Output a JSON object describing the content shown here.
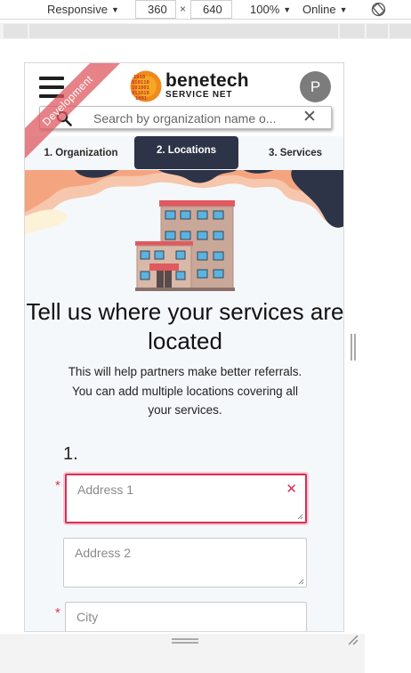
{
  "devtools": {
    "device": "Responsive",
    "width": "360",
    "height": "640",
    "times": "×",
    "zoom": "100%",
    "network": "Online",
    "icons": {
      "rotate": "rotate-icon",
      "caret": "caret-down-icon"
    }
  },
  "header": {
    "brand_line1": "benetech",
    "brand_line2": "SERVICE NET",
    "avatar_initial": "P",
    "search_placeholder": "Search by organization name o...",
    "search_clear": "✕",
    "ribbon": "Development",
    "icons": {
      "menu": "hamburger-menu-icon",
      "search": "search-icon",
      "clear": "close-icon",
      "logo": "benetech-logo-icon"
    }
  },
  "steps": [
    {
      "label": "1. Organization",
      "active": false
    },
    {
      "label": "2. Locations",
      "active": true
    },
    {
      "label": "3. Services",
      "active": false
    }
  ],
  "main": {
    "title": "Tell us where your services are located",
    "subtitle": "This will help partners make better referrals. You can add multiple locations covering all your services.",
    "location_number": "1.",
    "required_marker": "*",
    "fields": {
      "address1_placeholder": "Address 1",
      "address1_value": "",
      "address1_clear": "✕",
      "address2_placeholder": "Address 2",
      "address2_value": "",
      "city_placeholder": "City",
      "city_value": ""
    }
  },
  "colors": {
    "accent_navy": "#2d3448",
    "error_red": "#d92e55",
    "ribbon_red": "#de5860",
    "wave_orange": "#f6c6ad",
    "wave_yellow": "#fbf2d8"
  }
}
